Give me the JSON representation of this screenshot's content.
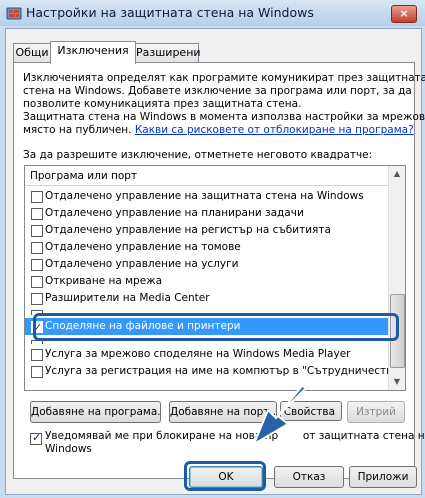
{
  "window": {
    "title": "Настройки на защитната стена на Windows",
    "close_icon": "×"
  },
  "tabs": [
    {
      "label": "Общи",
      "active": false
    },
    {
      "label": "Изключения",
      "active": true
    },
    {
      "label": "Разширени",
      "active": false
    }
  ],
  "description": {
    "line1": "Изключенията определят как програмите комуникират през защитната",
    "line2": "стена на Windows. Добавете изключение за програма или порт, за да",
    "line3": "позволите комуникацията през защитната стена.",
    "line4": "Защитната стена на Windows в момента използва настройки за мрежовото",
    "line5_prefix": "място на публичен.",
    "risk_link": "Какви са рисковете от отблокиране на програма?"
  },
  "allow_prompt": "За да разрешите изключение, отметнете неговото квадратче:",
  "list": {
    "header": "Програма или порт",
    "items": [
      {
        "label": "Отдалечено управление на защитната стена на Windows",
        "checked": false,
        "selected": false
      },
      {
        "label": "Отдалечено управление на планирани задачи",
        "checked": false,
        "selected": false
      },
      {
        "label": "Отдалечено управление на регистър на събитията",
        "checked": false,
        "selected": false
      },
      {
        "label": "Отдалечено управление на томове",
        "checked": false,
        "selected": false
      },
      {
        "label": "Отдалечено управление на услуги",
        "checked": false,
        "selected": false
      },
      {
        "label": "Откриване на мрежа",
        "checked": false,
        "selected": false
      },
      {
        "label": "Разширители на Media Center",
        "checked": false,
        "selected": false
      },
      {
        "label": "Споделяне на файлове и принтери",
        "checked": true,
        "selected": true
      },
      {
        "label": "Услуга за мрежово споделяне на Windows Media Player",
        "checked": false,
        "selected": false
      },
      {
        "label": "Услуга за регистрация на име на компютър в \"Сътрудничество ...",
        "checked": false,
        "selected": false
      }
    ]
  },
  "buttons": {
    "add_program": "Добавяне на програма...",
    "add_port": "Добавяне на порт...",
    "properties": "Свойства",
    "delete": "Изтрий",
    "ok": "OK",
    "cancel": "Отказ",
    "apply": "Приложи"
  },
  "notify": {
    "line1_a": "Уведомявай ме при блокиране на нова пр",
    "line1_b": "от защитната стена на",
    "line2": "Windows",
    "checked": true
  },
  "colors": {
    "accent": "#3399ff",
    "highlight": "#1f5b9f",
    "arrow": "#2a64a8"
  }
}
